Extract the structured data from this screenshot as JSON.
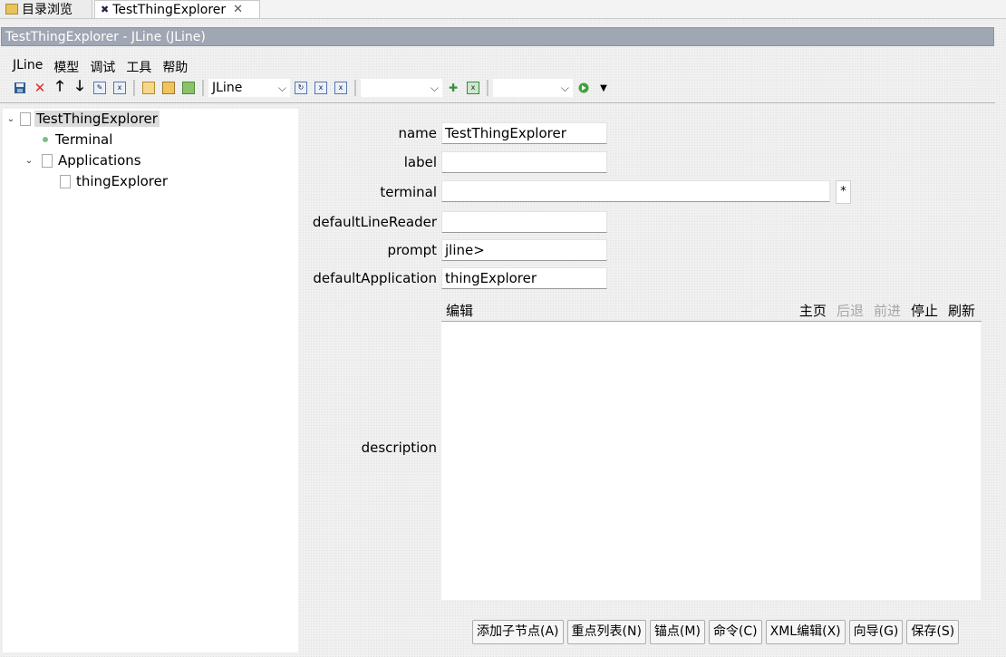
{
  "tabs": [
    {
      "label": "目录浏览",
      "icon": "folder-icon"
    },
    {
      "label": "TestThingExplorer",
      "icon": "thing-icon",
      "close": "✕"
    }
  ],
  "title": "TestThingExplorer - JLine  (JLine)",
  "menu": [
    "JLine",
    "模型",
    "调试",
    "工具",
    "帮助"
  ],
  "toolbar": {
    "combo1": "JLine",
    "combo2": "",
    "combo3": ""
  },
  "tree": [
    {
      "label": "TestThingExplorer",
      "level": 0,
      "expanded": true,
      "icon": "document-icon",
      "selected": true
    },
    {
      "label": "Terminal",
      "level": 1,
      "icon": "green-dot-icon"
    },
    {
      "label": "Applications",
      "level": 1,
      "expanded": true,
      "icon": "document-icon"
    },
    {
      "label": "thingExplorer",
      "level": 2,
      "icon": "document-icon"
    }
  ],
  "form": {
    "name": {
      "label": "name",
      "value": "TestThingExplorer"
    },
    "label": {
      "label": "label",
      "value": ""
    },
    "terminal": {
      "label": "terminal",
      "value": "",
      "button": "*"
    },
    "defaultLineReader": {
      "label": "defaultLineReader",
      "value": ""
    },
    "prompt": {
      "label": "prompt",
      "value": "jline>"
    },
    "defaultApplication": {
      "label": "defaultApplication",
      "value": "thingExplorer"
    },
    "description": {
      "label": "description"
    }
  },
  "editor": {
    "label": "编辑",
    "nav": {
      "home": "主页",
      "back": "后退",
      "forward": "前进",
      "stop": "停止",
      "refresh": "刷新"
    }
  },
  "buttons": {
    "add_child": "添加子节点(A)",
    "list": "重点列表(N)",
    "anchor": "锚点(M)",
    "command": "命令(C)",
    "xml_edit": "XML编辑(X)",
    "wizard": "向导(G)",
    "save": "保存(S)"
  }
}
